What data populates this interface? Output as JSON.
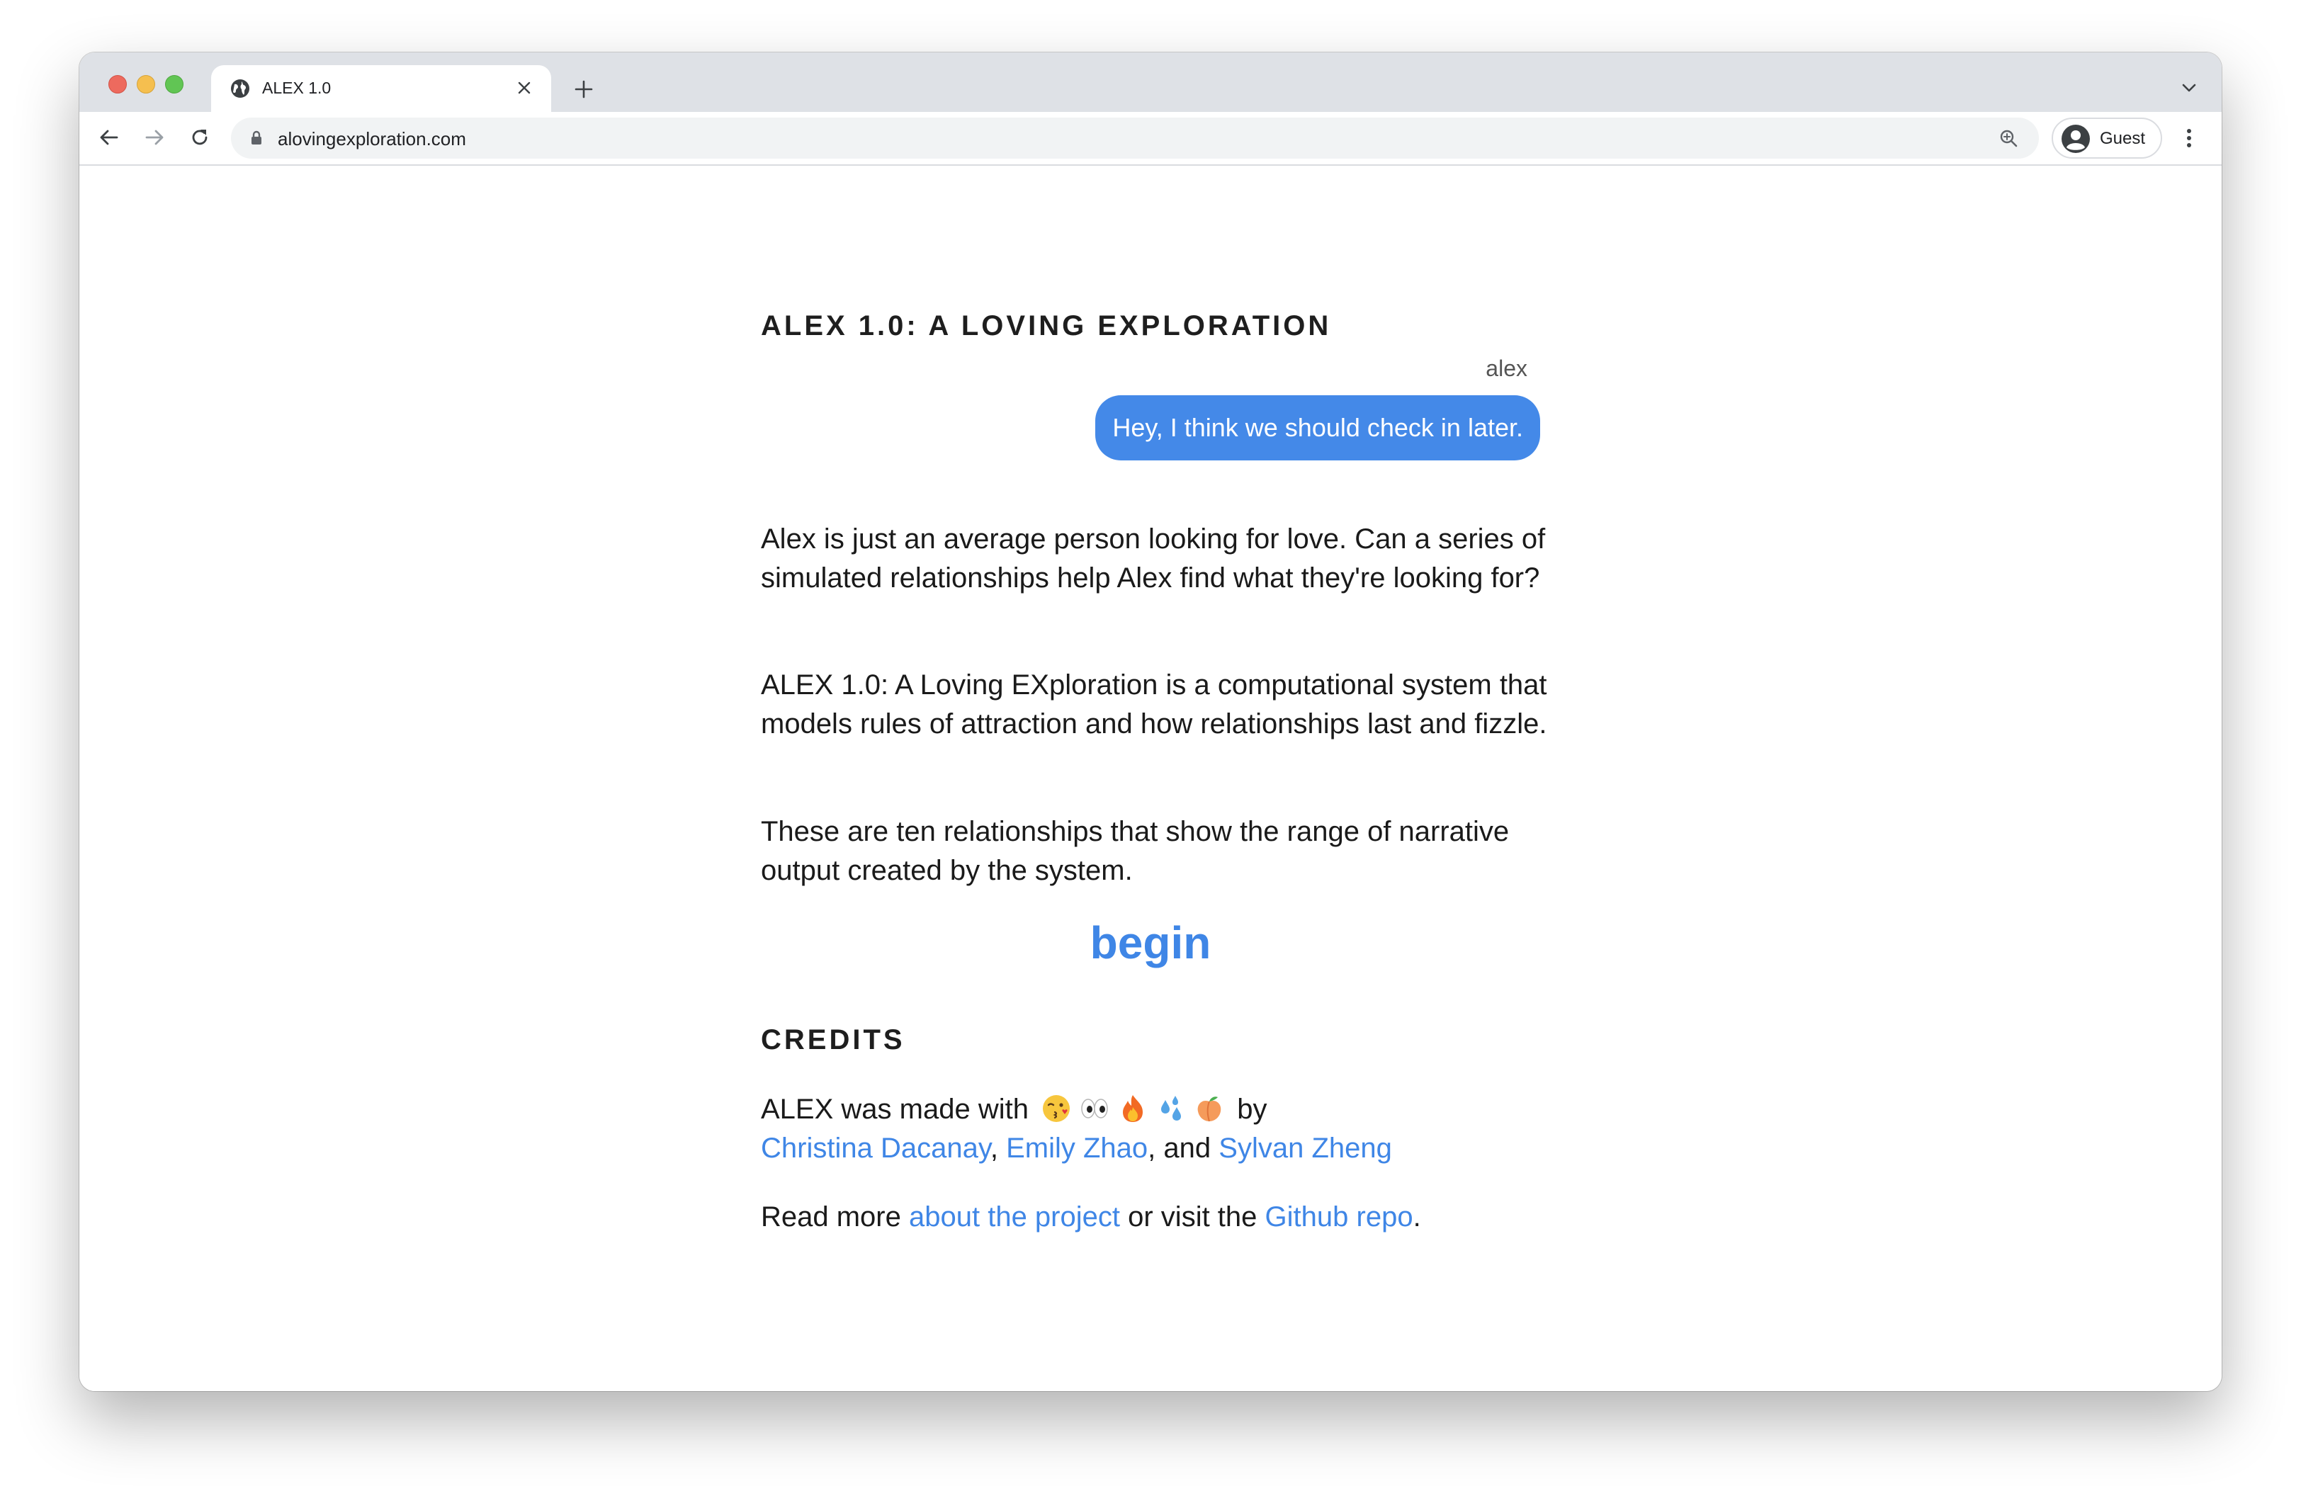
{
  "browser": {
    "tab_title": "ALEX 1.0",
    "url": "alovingexploration.com",
    "profile_label": "Guest"
  },
  "page": {
    "title": "ALEX 1.0: A LOVING EXPLORATION",
    "chat": {
      "sender": "alex",
      "message": "Hey, I think we should check in later."
    },
    "paragraphs": [
      "Alex is just an average person looking for love. Can a series of simulated relationships help Alex find what they're looking for?",
      "ALEX 1.0: A Loving EXploration is a computational system that models rules of attraction and how relationships last and fizzle.",
      "These are ten relationships that show the range of narrative output created by the system."
    ],
    "begin_label": "begin",
    "credits": {
      "title": "CREDITS",
      "made_with": "ALEX was made with",
      "emojis": [
        "kissing-face-emoji",
        "eyes-emoji",
        "fire-emoji",
        "sweat-droplets-emoji",
        "peach-emoji"
      ],
      "by": "by",
      "authors": [
        "Christina Dacanay",
        "Emily Zhao",
        "Sylvan Zheng"
      ],
      "sep_comma": ",",
      "sep_and": ", and",
      "read_more_prefix": "Read more",
      "about_link": "about the project",
      "visit_text": "or visit the",
      "github_link": "Github repo",
      "period": "."
    }
  },
  "colors": {
    "link": "#3f86e6",
    "bubble": "#4489e8",
    "tab_strip": "#dee1e6"
  }
}
